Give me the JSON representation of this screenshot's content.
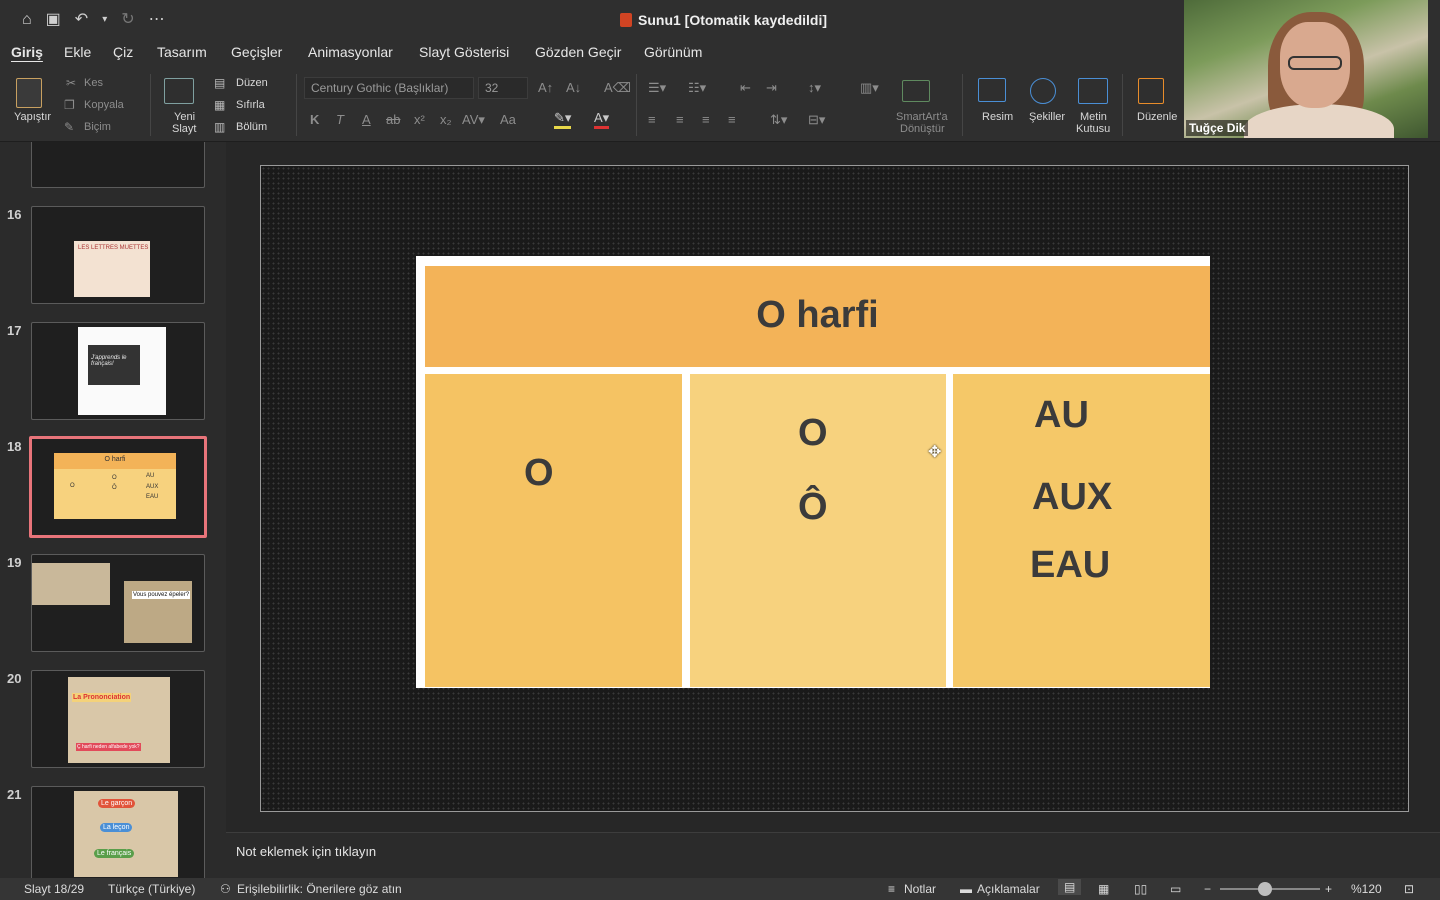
{
  "titlebar": {
    "document_title": "Sunu1 [Otomatik kaydedildi]",
    "icons": [
      "home-icon",
      "save-icon",
      "undo-icon",
      "redo-icon",
      "more-icon"
    ]
  },
  "tabs": [
    "Giriş",
    "Ekle",
    "Çiz",
    "Tasarım",
    "Geçişler",
    "Animasyonlar",
    "Slayt Gösterisi",
    "Gözden Geçir",
    "Görünüm"
  ],
  "active_tab": "Giriş",
  "ribbon": {
    "paste": "Yapıştır",
    "cut": "Kes",
    "copy": "Kopyala",
    "format": "Biçim",
    "new_slide_line1": "Yeni",
    "new_slide_line2": "Slayt",
    "layout": "Düzen",
    "reset": "Sıfırla",
    "section": "Bölüm",
    "font_name": "Century Gothic (Başlıklar)",
    "font_size": "32",
    "bold": "K",
    "italic": "T",
    "underline": "A",
    "strike": "ab",
    "change_case": "Aa",
    "smartart_line1": "SmartArt'a",
    "smartart_line2": "Dönüştür",
    "picture": "Resim",
    "shapes": "Şekiller",
    "textbox_line1": "Metin",
    "textbox_line2": "Kutusu",
    "arrange": "Düzenle"
  },
  "webcam": {
    "participant_name": "Tuğçe Dik"
  },
  "thumbnails": [
    {
      "num": "16",
      "title": "LES LETTRES MUETTES"
    },
    {
      "num": "17",
      "title": "J'apprends le français!"
    },
    {
      "num": "18",
      "title": "O harfi",
      "cells": [
        "O",
        "O",
        "Ô",
        "AU",
        "AUX",
        "EAU"
      ]
    },
    {
      "num": "19",
      "title": "Vous pouvez épeler?"
    },
    {
      "num": "20",
      "title": "La Prononciation",
      "subtitle": "Ç harfi neden alfabede yok?"
    },
    {
      "num": "21",
      "items": [
        "Le garçon",
        "La leçon",
        "Le français"
      ]
    }
  ],
  "slide": {
    "title": "O harfi",
    "col1": [
      "O"
    ],
    "col2": [
      "O",
      "Ô"
    ],
    "col3": [
      "AU",
      "AUX",
      "EAU"
    ]
  },
  "notes_placeholder": "Not eklemek için tıklayın",
  "status": {
    "slide_info": "Slayt 18/29",
    "language": "Türkçe (Türkiye)",
    "accessibility": "Erişilebilirlik: Önerilere göz atın",
    "notes": "Notlar",
    "comments": "Açıklamalar",
    "zoom": "%120",
    "zoom_level": 0.45
  },
  "colors": {
    "header": "#f3b358",
    "col1": "#f5c363",
    "col2": "#f7d27e",
    "col3": "#f5c868",
    "selected_border": "#e8747a"
  }
}
